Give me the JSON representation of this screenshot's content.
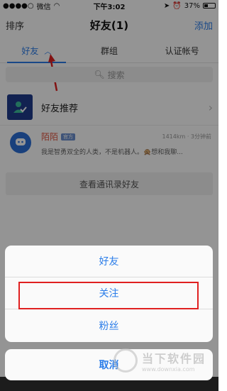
{
  "status_bar": {
    "carrier": "微信",
    "time": "下午3:02",
    "battery_text": "37%",
    "battery_level": 0.37
  },
  "navbar": {
    "left": "排序",
    "title": "好友(1)",
    "right": "添加"
  },
  "tabs": [
    {
      "label": "好友",
      "active": true
    },
    {
      "label": "群组",
      "active": false
    },
    {
      "label": "认证帐号",
      "active": false
    }
  ],
  "search": {
    "placeholder": "搜索"
  },
  "recommend": {
    "label": "好友推荐"
  },
  "contact": {
    "name": "陌陌",
    "badge": "官方",
    "meta": "1414km · 3分钟前",
    "message": "我是智勇双全的人类，不是机器人。🙊想和我聊..."
  },
  "view_contacts_button": "查看通讯录好友",
  "action_sheet": {
    "items": [
      "好友",
      "关注",
      "粉丝"
    ],
    "highlighted": "关注",
    "cancel": "取消"
  },
  "watermark": {
    "cn": "当下软件园",
    "url": "www.downxia.com"
  },
  "colors": {
    "accent": "#2b7de9",
    "highlight": "#e02020",
    "contact_name": "#e0553f"
  }
}
